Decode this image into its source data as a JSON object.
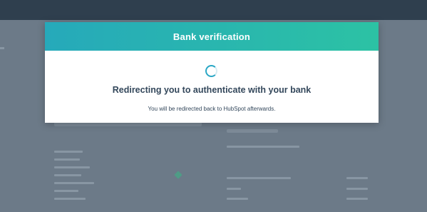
{
  "modal": {
    "title": "Bank verification",
    "heading": "Redirecting you to authenticate with your bank",
    "subtext": "You will be redirected back to HubSpot afterwards.",
    "status": "loading"
  },
  "colors": {
    "header_gradient_start": "#26a9ba",
    "header_gradient_end": "#2cc2a4",
    "text": "#33475b",
    "spinner": "#2aa7c5"
  },
  "icons": {
    "spinner": "loading-spinner-icon",
    "background_edit": "pencil-icon"
  }
}
